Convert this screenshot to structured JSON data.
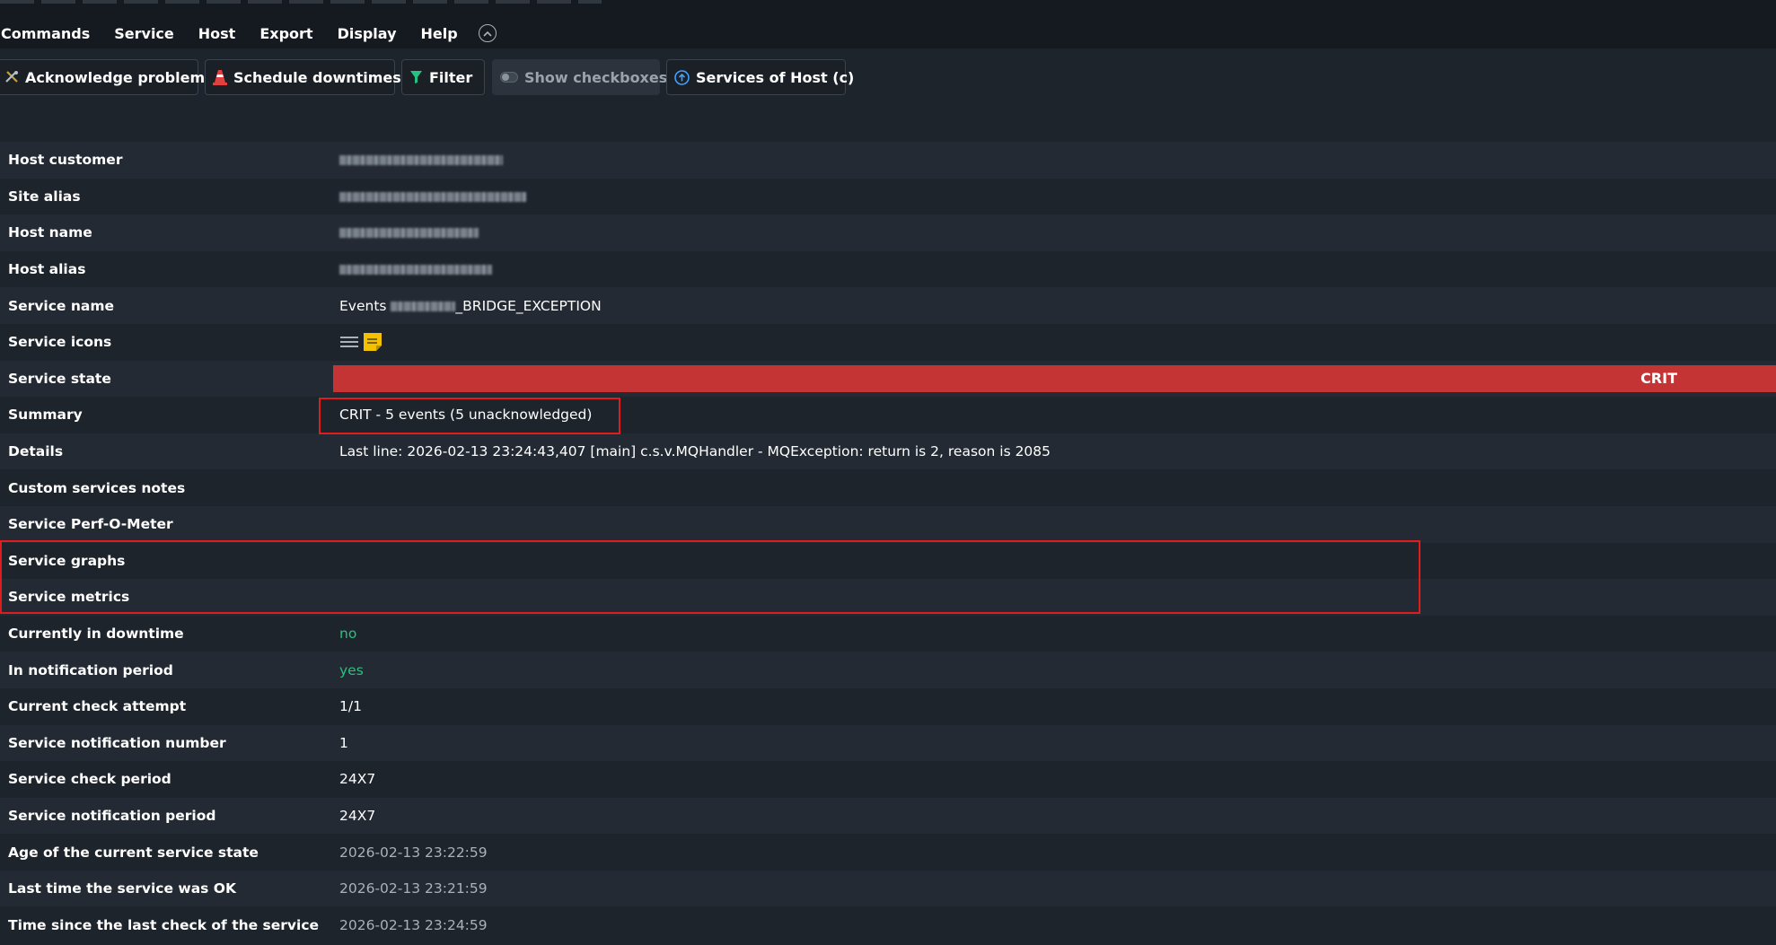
{
  "menu": {
    "items": [
      "Commands",
      "Service",
      "Host",
      "Export",
      "Display",
      "Help"
    ]
  },
  "toolbar": {
    "acknowledge_label": "Acknowledge problems",
    "schedule_label": "Schedule downtimes",
    "filter_label": "Filter",
    "checkboxes_label": "Show checkboxes",
    "services_of_host_label": "Services of Host (c)"
  },
  "rows": {
    "host_customer": {
      "label": "Host customer"
    },
    "site_alias": {
      "label": "Site alias"
    },
    "host_name": {
      "label": "Host name"
    },
    "host_alias": {
      "label": "Host alias"
    },
    "service_name": {
      "label": "Service name",
      "prefix": "Events",
      "suffix": "_BRIDGE_EXCEPTION"
    },
    "service_icons": {
      "label": "Service icons"
    },
    "service_state": {
      "label": "Service state",
      "value": "CRIT"
    },
    "summary": {
      "label": "Summary",
      "value": "CRIT - 5 events (5 unacknowledged)"
    },
    "details": {
      "label": "Details",
      "value": "Last line: 2026-02-13 23:24:43,407 [main] c.s.v.MQHandler - MQException: return is 2, reason is 2085"
    },
    "custom_notes": {
      "label": "Custom services notes"
    },
    "perf_o_meter": {
      "label": "Service Perf-O-Meter"
    },
    "graphs": {
      "label": "Service graphs"
    },
    "metrics": {
      "label": "Service metrics"
    },
    "in_downtime": {
      "label": "Currently in downtime",
      "value": "no"
    },
    "in_notification_period": {
      "label": "In notification period",
      "value": "yes"
    },
    "check_attempt": {
      "label": "Current check attempt",
      "value": "1/1"
    },
    "notification_number": {
      "label": "Service notification number",
      "value": "1"
    },
    "check_period": {
      "label": "Service check period",
      "value": "24X7"
    },
    "notification_period": {
      "label": "Service notification period",
      "value": "24X7"
    },
    "age_state": {
      "label": "Age of the current service state",
      "value": "2026-02-13 23:22:59"
    },
    "last_ok": {
      "label": "Last time the service was OK",
      "value": "2026-02-13 23:21:59"
    },
    "since_last_check": {
      "label": "Time since the last check of the service",
      "value": "2026-02-13 23:24:59"
    }
  },
  "colors": {
    "crit": "#c43434",
    "ok_green": "#26c281",
    "highlight": "#e01c1c"
  }
}
